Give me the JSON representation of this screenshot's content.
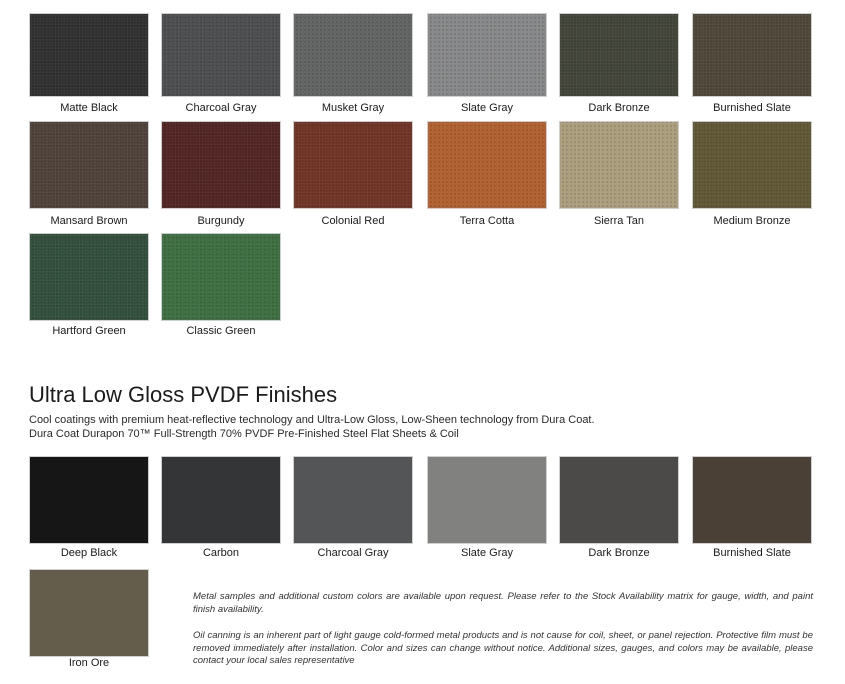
{
  "standard_finishes": [
    {
      "label": "Matte Black",
      "color": "#2d2d2e"
    },
    {
      "label": "Charcoal Gray",
      "color": "#4a4b4c"
    },
    {
      "label": "Musket Gray",
      "color": "#606161"
    },
    {
      "label": "Slate Gray",
      "color": "#858687"
    },
    {
      "label": "Dark Bronze",
      "color": "#3f4236"
    },
    {
      "label": "Burnished Slate",
      "color": "#4c4536"
    },
    {
      "label": "Mansard Brown",
      "color": "#4c3f37"
    },
    {
      "label": "Burgundy",
      "color": "#4f2220"
    },
    {
      "label": "Colonial Red",
      "color": "#6e3122"
    },
    {
      "label": "Terra Cotta",
      "color": "#b05f2c"
    },
    {
      "label": "Sierra Tan",
      "color": "#ab9d7b"
    },
    {
      "label": "Medium Bronze",
      "color": "#5f5532"
    },
    {
      "label": "Hartford Green",
      "color": "#2f4c3a"
    },
    {
      "label": "Classic Green",
      "color": "#3b6c3e"
    }
  ],
  "ultra_low_gloss": {
    "title": "Ultra Low Gloss PVDF Finishes",
    "description_line_1": "Cool coatings with premium heat-reflective technology and Ultra-Low Gloss, Low-Sheen technology from Dura Coat.",
    "description_line_2": "Dura Coat Durapon 70™ Full-Strength 70% PVDF Pre-Finished Steel Flat Sheets & Coil",
    "finishes": [
      {
        "label": "Deep Black",
        "color": "#161616"
      },
      {
        "label": "Carbon",
        "color": "#343536"
      },
      {
        "label": "Charcoal Gray",
        "color": "#535556"
      },
      {
        "label": "Slate Gray",
        "color": "#81817f"
      },
      {
        "label": "Dark Bronze",
        "color": "#4b4a48"
      },
      {
        "label": "Burnished Slate",
        "color": "#4a4035"
      },
      {
        "label": "Iron Ore",
        "color": "#655d4b"
      }
    ]
  },
  "notes": {
    "note_1": "Metal samples and additional custom colors are available upon request. Please refer to the Stock Availability matrix for gauge, width, and paint finish availability.",
    "note_2": "Oil canning is an inherent part of light gauge cold-formed metal products and is not cause for coil, sheet, or panel rejection. Protective film must be removed immediately after installation. Color and sizes can change without notice. Additional sizes, gauges, and colors may be available, please contact your local sales representative"
  }
}
